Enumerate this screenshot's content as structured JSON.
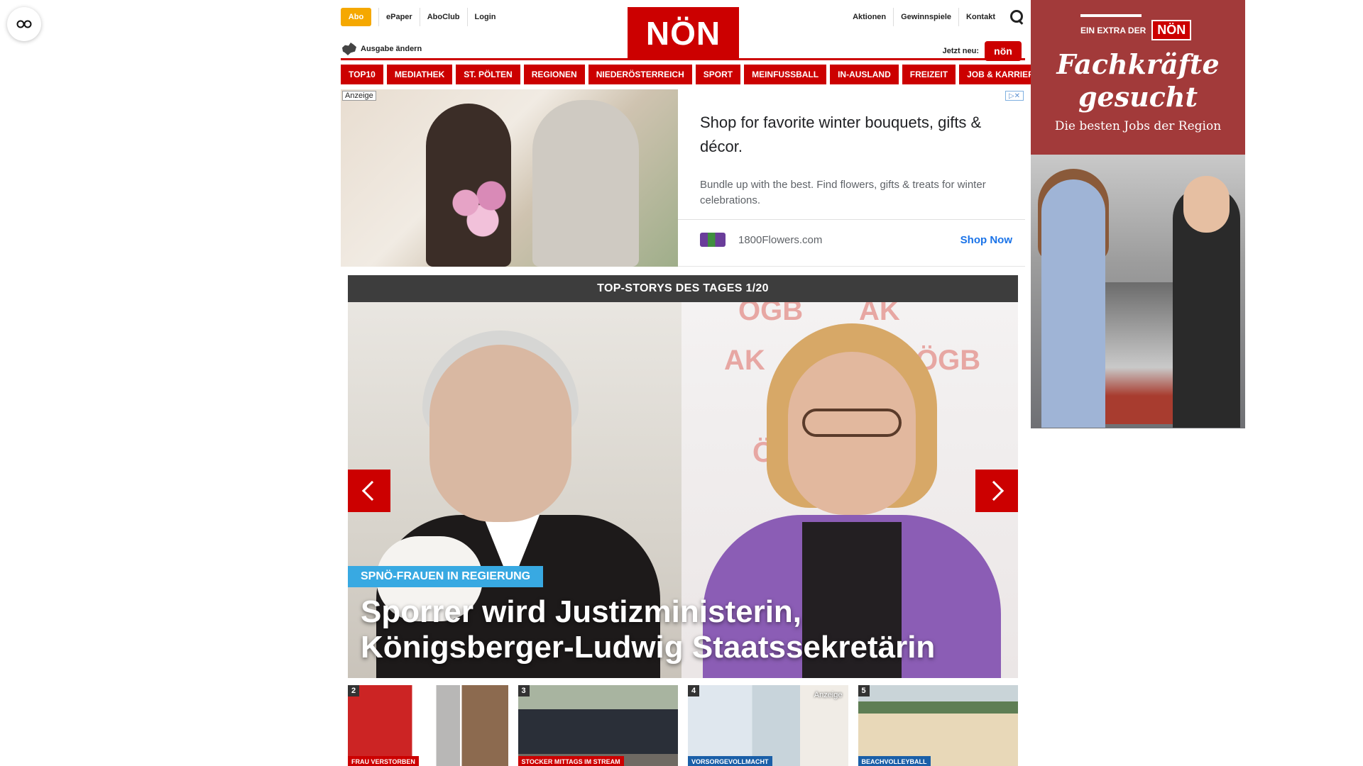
{
  "header": {
    "abo_label": "Abo",
    "links_left": [
      "ePaper",
      "AboClub",
      "Login"
    ],
    "logo_text": "NÖN",
    "links_right": [
      "Aktionen",
      "Gewinnspiele",
      "Kontakt"
    ],
    "ausgabe_label": "Ausgabe ändern",
    "jetzt_label": "Jetzt neu:",
    "jetzt_badge": "nön"
  },
  "nav": {
    "items": [
      "TOP10",
      "MEDIATHEK",
      "ST. PÖLTEN",
      "REGIONEN",
      "NIEDERÖSTERREICH",
      "SPORT",
      "MEINFUSSBALL",
      "IN-AUSLAND",
      "FREIZEIT",
      "JOB & KARRIERE"
    ]
  },
  "ad": {
    "label": "Anzeige",
    "title": "Shop for favorite winter bouquets, gifts & décor.",
    "description": "Bundle up with the best. Find flowers, gifts & treats for winter celebrations.",
    "brand": "1800Flowers.com",
    "cta": "Shop Now"
  },
  "stories": {
    "heading": "TOP-STORYS DES TAGES 1/20",
    "hero": {
      "kicker": "SPNÖ-FRAUEN IN REGIERUNG",
      "headline": "Sporrer wird Justizministerin, Königsberger-Ludwig Staatssekretärin",
      "bg_marks": [
        "ÖGB",
        "AK",
        "ÖGB",
        "AK",
        "Ö"
      ]
    },
    "thumbs": [
      {
        "num": "2",
        "tag": "FRAU VERSTORBEN",
        "color": "#cc0000"
      },
      {
        "num": "3",
        "tag": "STOCKER MITTAGS IM STREAM",
        "color": "#cc0000"
      },
      {
        "num": "4",
        "tag": "VORSORGEVOLLMACHT",
        "color": "#1a5fa8",
        "anzeige": "Anzeige"
      },
      {
        "num": "5",
        "tag": "BEACHVOLLEYBALL",
        "color": "#1a5fa8"
      }
    ]
  },
  "side_ad": {
    "extra_label": "EIN EXTRA DER",
    "extra_logo": "NÖN",
    "headline": "Fachkräfte gesucht",
    "sub": "Die besten Jobs der Region"
  },
  "colors": {
    "brand_red": "#cc0000",
    "abo_orange": "#f5a800",
    "kicker_blue": "#38a9e2",
    "side_ad_bg": "#a23a3a"
  }
}
